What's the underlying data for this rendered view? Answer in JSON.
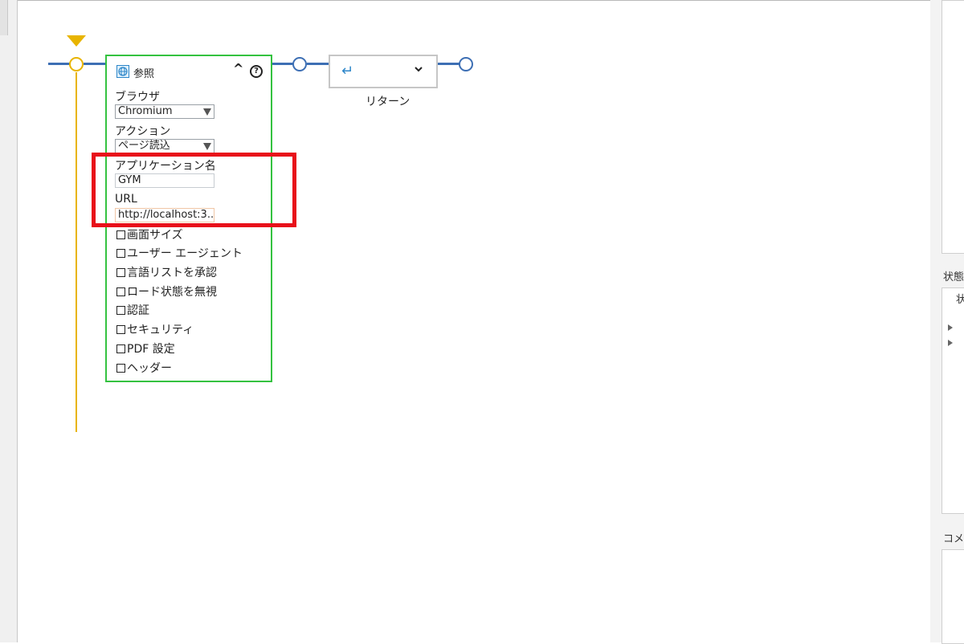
{
  "activity": {
    "title": "参照",
    "fields": {
      "browser_label": "ブラウザ",
      "browser_value": "Chromium",
      "action_label": "アクション",
      "action_value": "ページ読込",
      "app_name_label": "アプリケーション名",
      "app_name_value": "GYM",
      "url_label": "URL",
      "url_value": "http://localhost:3..."
    },
    "options": [
      "画面サイズ",
      "ユーザー エージェント",
      "言語リストを承認",
      "ロード状態を無視",
      "認証",
      "セキュリティ",
      "PDF 設定",
      "ヘッダー"
    ]
  },
  "return_activity": {
    "label": "リターン",
    "icon": "↵",
    "chevron": "⌄"
  },
  "right_panel": {
    "header1": "状態",
    "header2": "コメント",
    "text1": "状"
  },
  "colors": {
    "flow_blue": "#3d6fb4",
    "start_yellow": "#e8b400",
    "card_border_green": "#34c240",
    "highlight_red": "#e8101a"
  }
}
